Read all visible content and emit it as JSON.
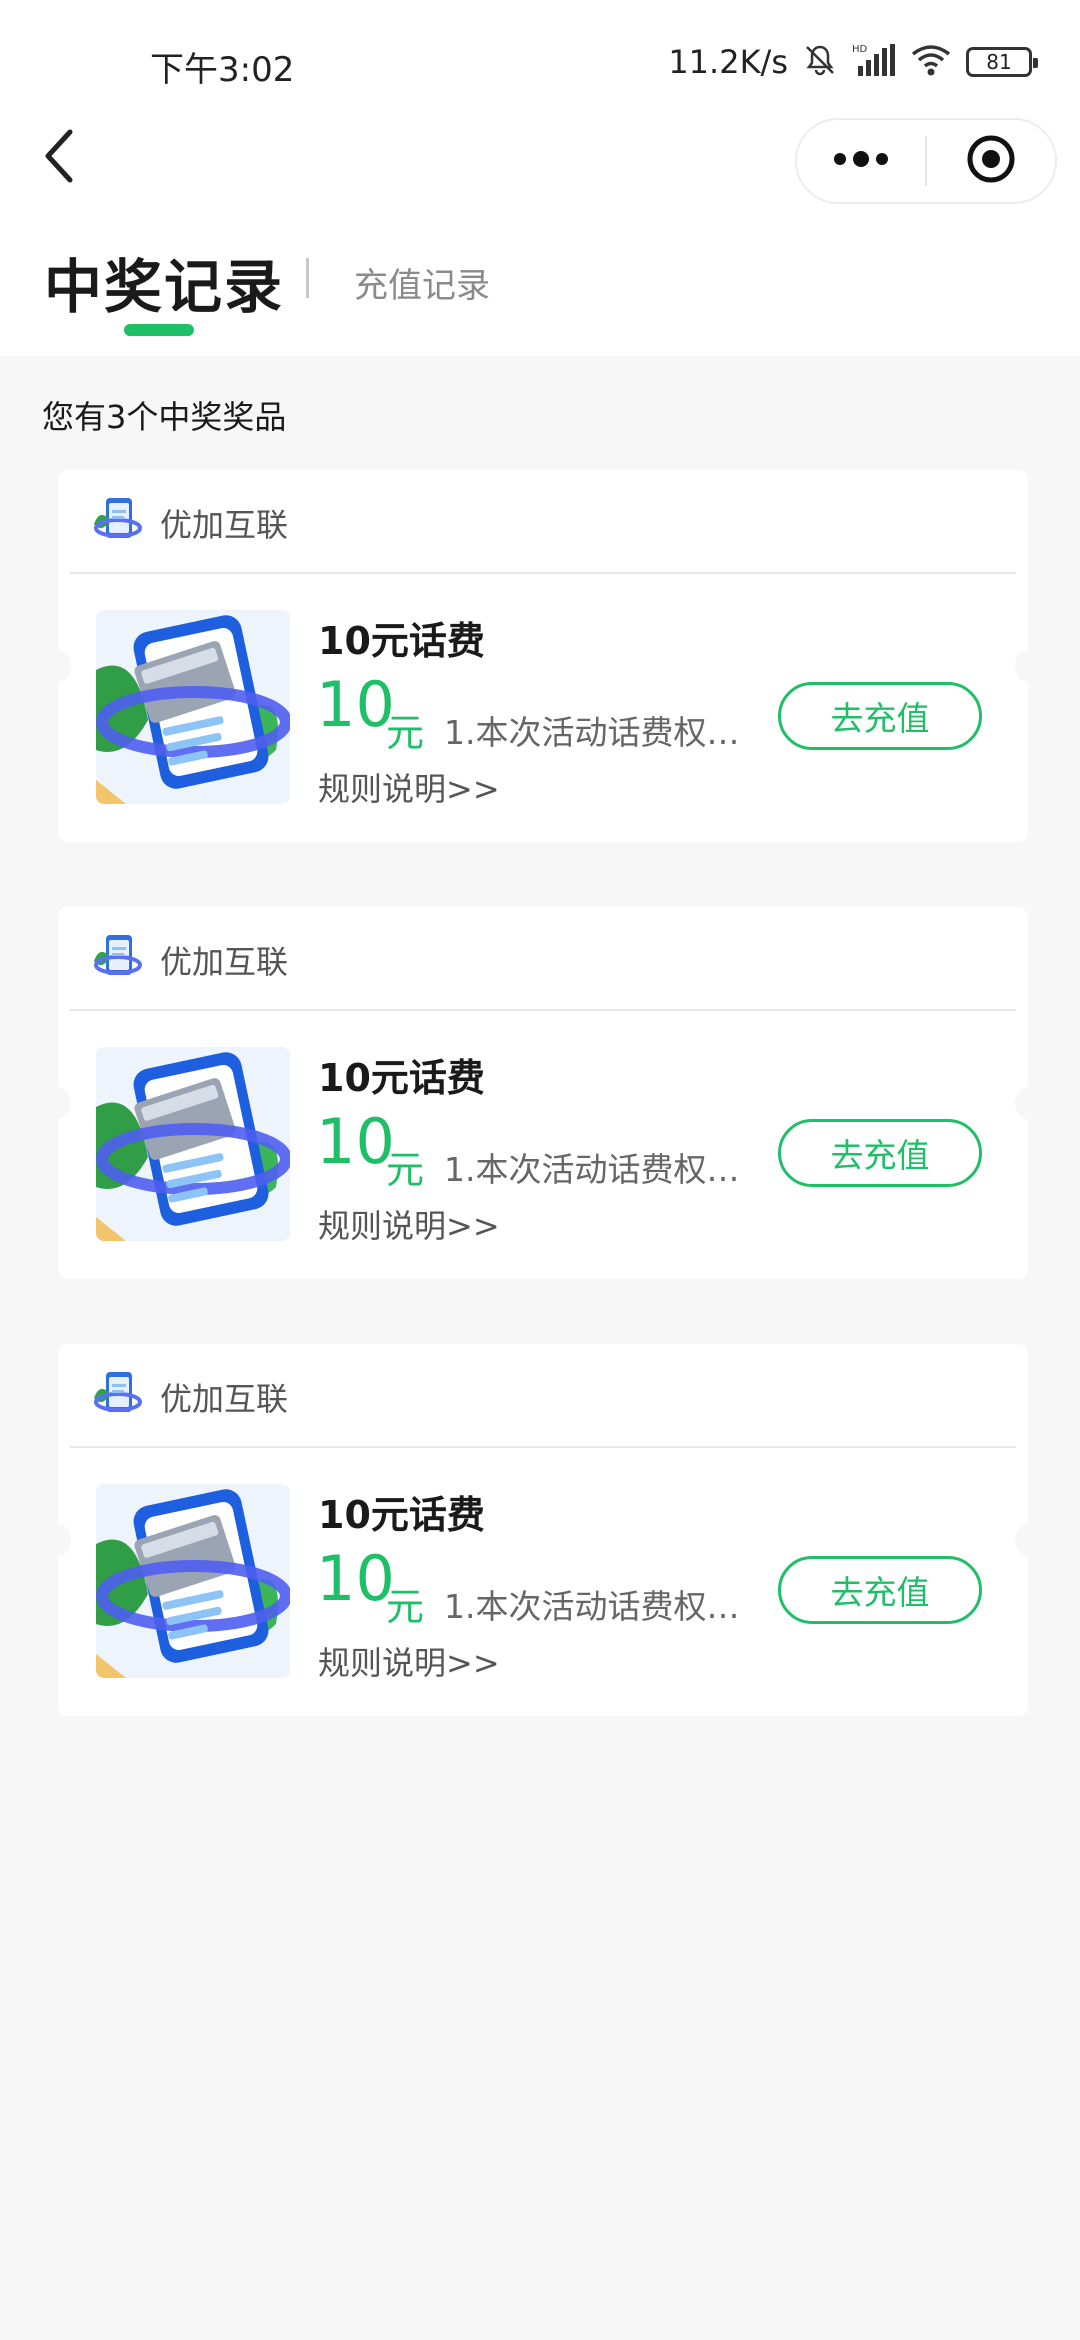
{
  "status_bar": {
    "time": "下午3:02",
    "net_speed": "11.2K/s",
    "battery": "81"
  },
  "nav": {
    "back_icon": "chevron-left-icon",
    "more_icon": "more-dots-icon",
    "target_icon": "target-icon"
  },
  "tabs": {
    "active": "中奖记录",
    "inactive": "充值记录"
  },
  "summary": "您有3个中奖奖品",
  "prizes": [
    {
      "merchant": "优加互联",
      "title": "10元话费",
      "amount": "10",
      "unit": "元",
      "description": "1.本次活动话费权…",
      "rules": "规则说明>>",
      "action": "去充值"
    },
    {
      "merchant": "优加互联",
      "title": "10元话费",
      "amount": "10",
      "unit": "元",
      "description": "1.本次活动话费权…",
      "rules": "规则说明>>",
      "action": "去充值"
    },
    {
      "merchant": "优加互联",
      "title": "10元话费",
      "amount": "10",
      "unit": "元",
      "description": "1.本次活动话费权…",
      "rules": "规则说明>>",
      "action": "去充值"
    }
  ],
  "colors": {
    "accent": "#1fbf67",
    "background": "#f7f7f7"
  }
}
